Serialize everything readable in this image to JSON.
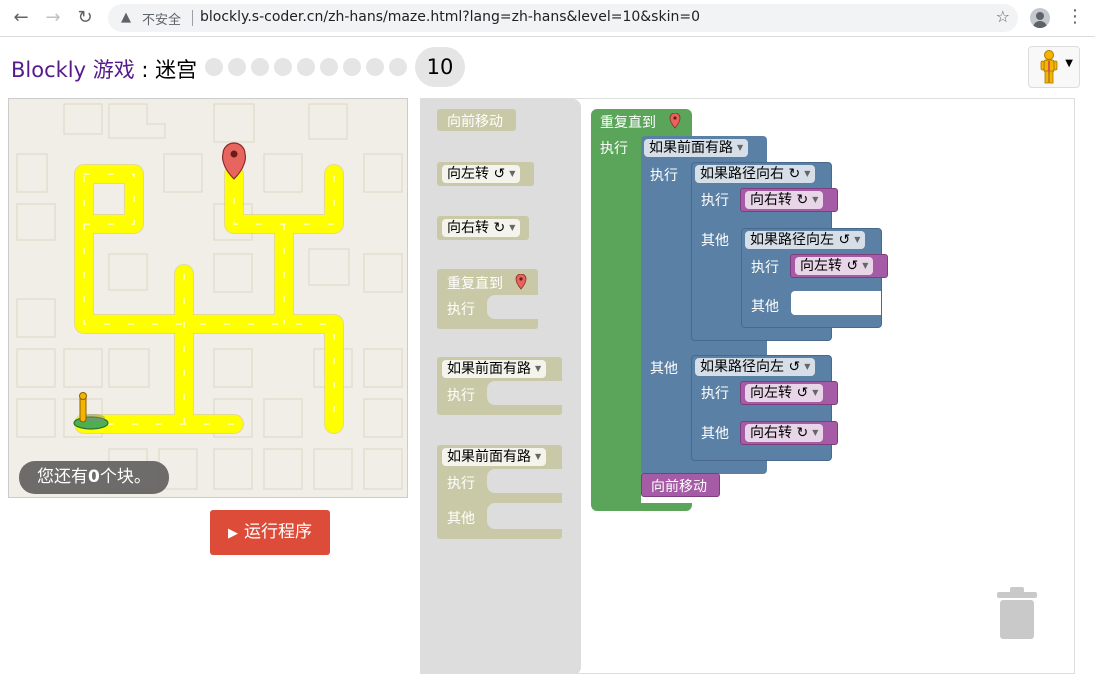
{
  "browser": {
    "security_label": "不安全",
    "url": "blockly.s-coder.cn/zh-hans/maze.html?lang=zh-hans&level=10&skin=0"
  },
  "header": {
    "title_link": "Blockly 游戏",
    "title_separator": " : ",
    "title_page": "迷宫",
    "current_level": "10",
    "level_count": 10
  },
  "maze": {
    "capacity_prefix": "您还有",
    "capacity_count": "0",
    "capacity_suffix": "个块。"
  },
  "run_button": {
    "label": "运行程序"
  },
  "toolbox": {
    "move_forward": "向前移动",
    "turn_left": "向左转 ↺",
    "turn_right": "向右转 ↻",
    "repeat_until": "重复直到",
    "do": "执行",
    "if_path": "如果前面有路",
    "else": "其他"
  },
  "program": {
    "repeat_label": "重复直到",
    "do_label": "执行",
    "else_label": "其他",
    "if_ahead": "如果前面有路",
    "if_right": "如果路径向右 ↻",
    "if_left": "如果路径向左 ↺",
    "turn_right": "向右转 ↻",
    "turn_left": "向左转 ↺",
    "move_forward": "向前移动"
  },
  "colors": {
    "loop_block": "#5ba55b",
    "logic_block": "#5b80a5",
    "action_block": "#a55ba5",
    "run_button": "#dd4b39",
    "path": "#ffff00"
  }
}
